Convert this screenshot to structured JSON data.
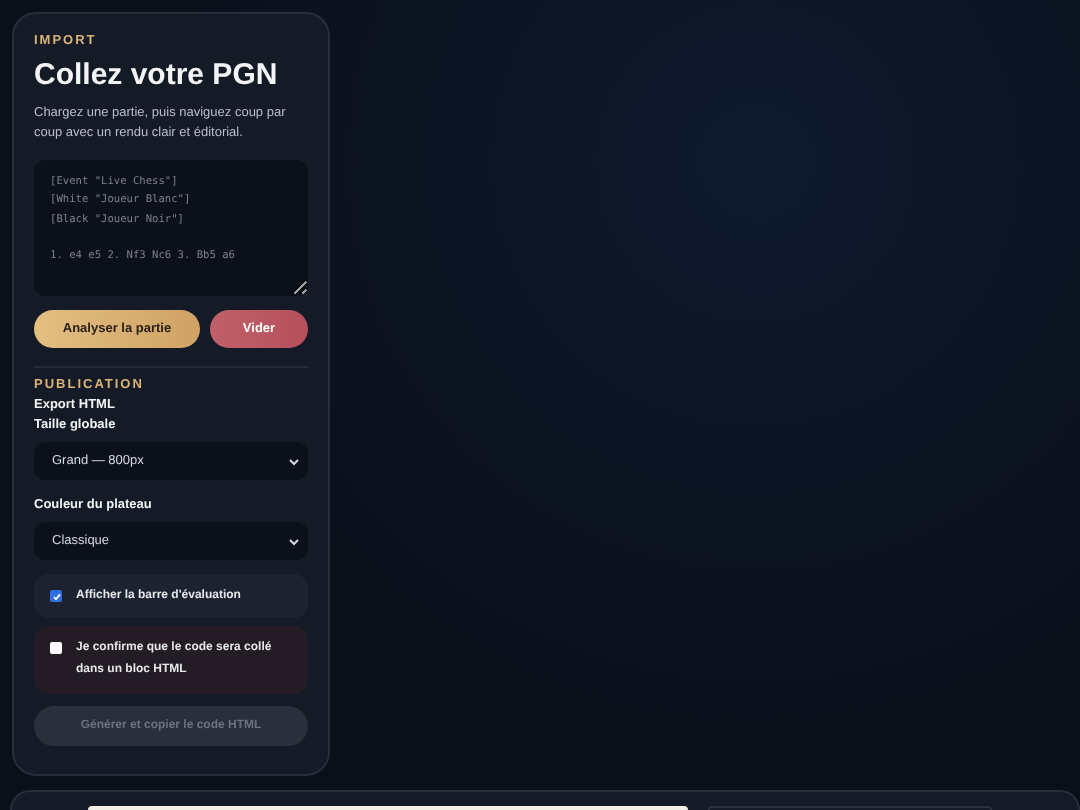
{
  "import": {
    "eyebrow": "IMPORT",
    "title": "Collez votre PGN",
    "description": "Chargez une partie, puis naviguez coup par coup avec un rendu clair et éditorial.",
    "pgn": {
      "placeholder": "[Event \"Live Chess\"]\n[White \"Joueur Blanc\"]\n[Black \"Joueur Noir\"]\n\n1. e4 e5 2. Nf3 Nc6 3. Bb5 a6"
    },
    "buttons": [
      {
        "label": "Analyser la partie",
        "kind": "primary"
      },
      {
        "label": "Vider",
        "kind": "danger"
      }
    ]
  },
  "publication": {
    "eyebrow": "PUBLICATION",
    "subtitle": "Export HTML",
    "fields": [
      {
        "label": "Taille globale",
        "value": "Grand — 800px"
      },
      {
        "label": "Couleur du plateau",
        "value": "Classique"
      }
    ],
    "options": [
      {
        "label": "Afficher la barre d'évaluation",
        "checked": true,
        "kind": "plain"
      },
      {
        "label": "Je confirme que le code sera collé dans un bloc HTML",
        "checked": false,
        "kind": "warning"
      }
    ],
    "action": {
      "label": "Générer et copier le code HTML",
      "disabled": true
    }
  }
}
